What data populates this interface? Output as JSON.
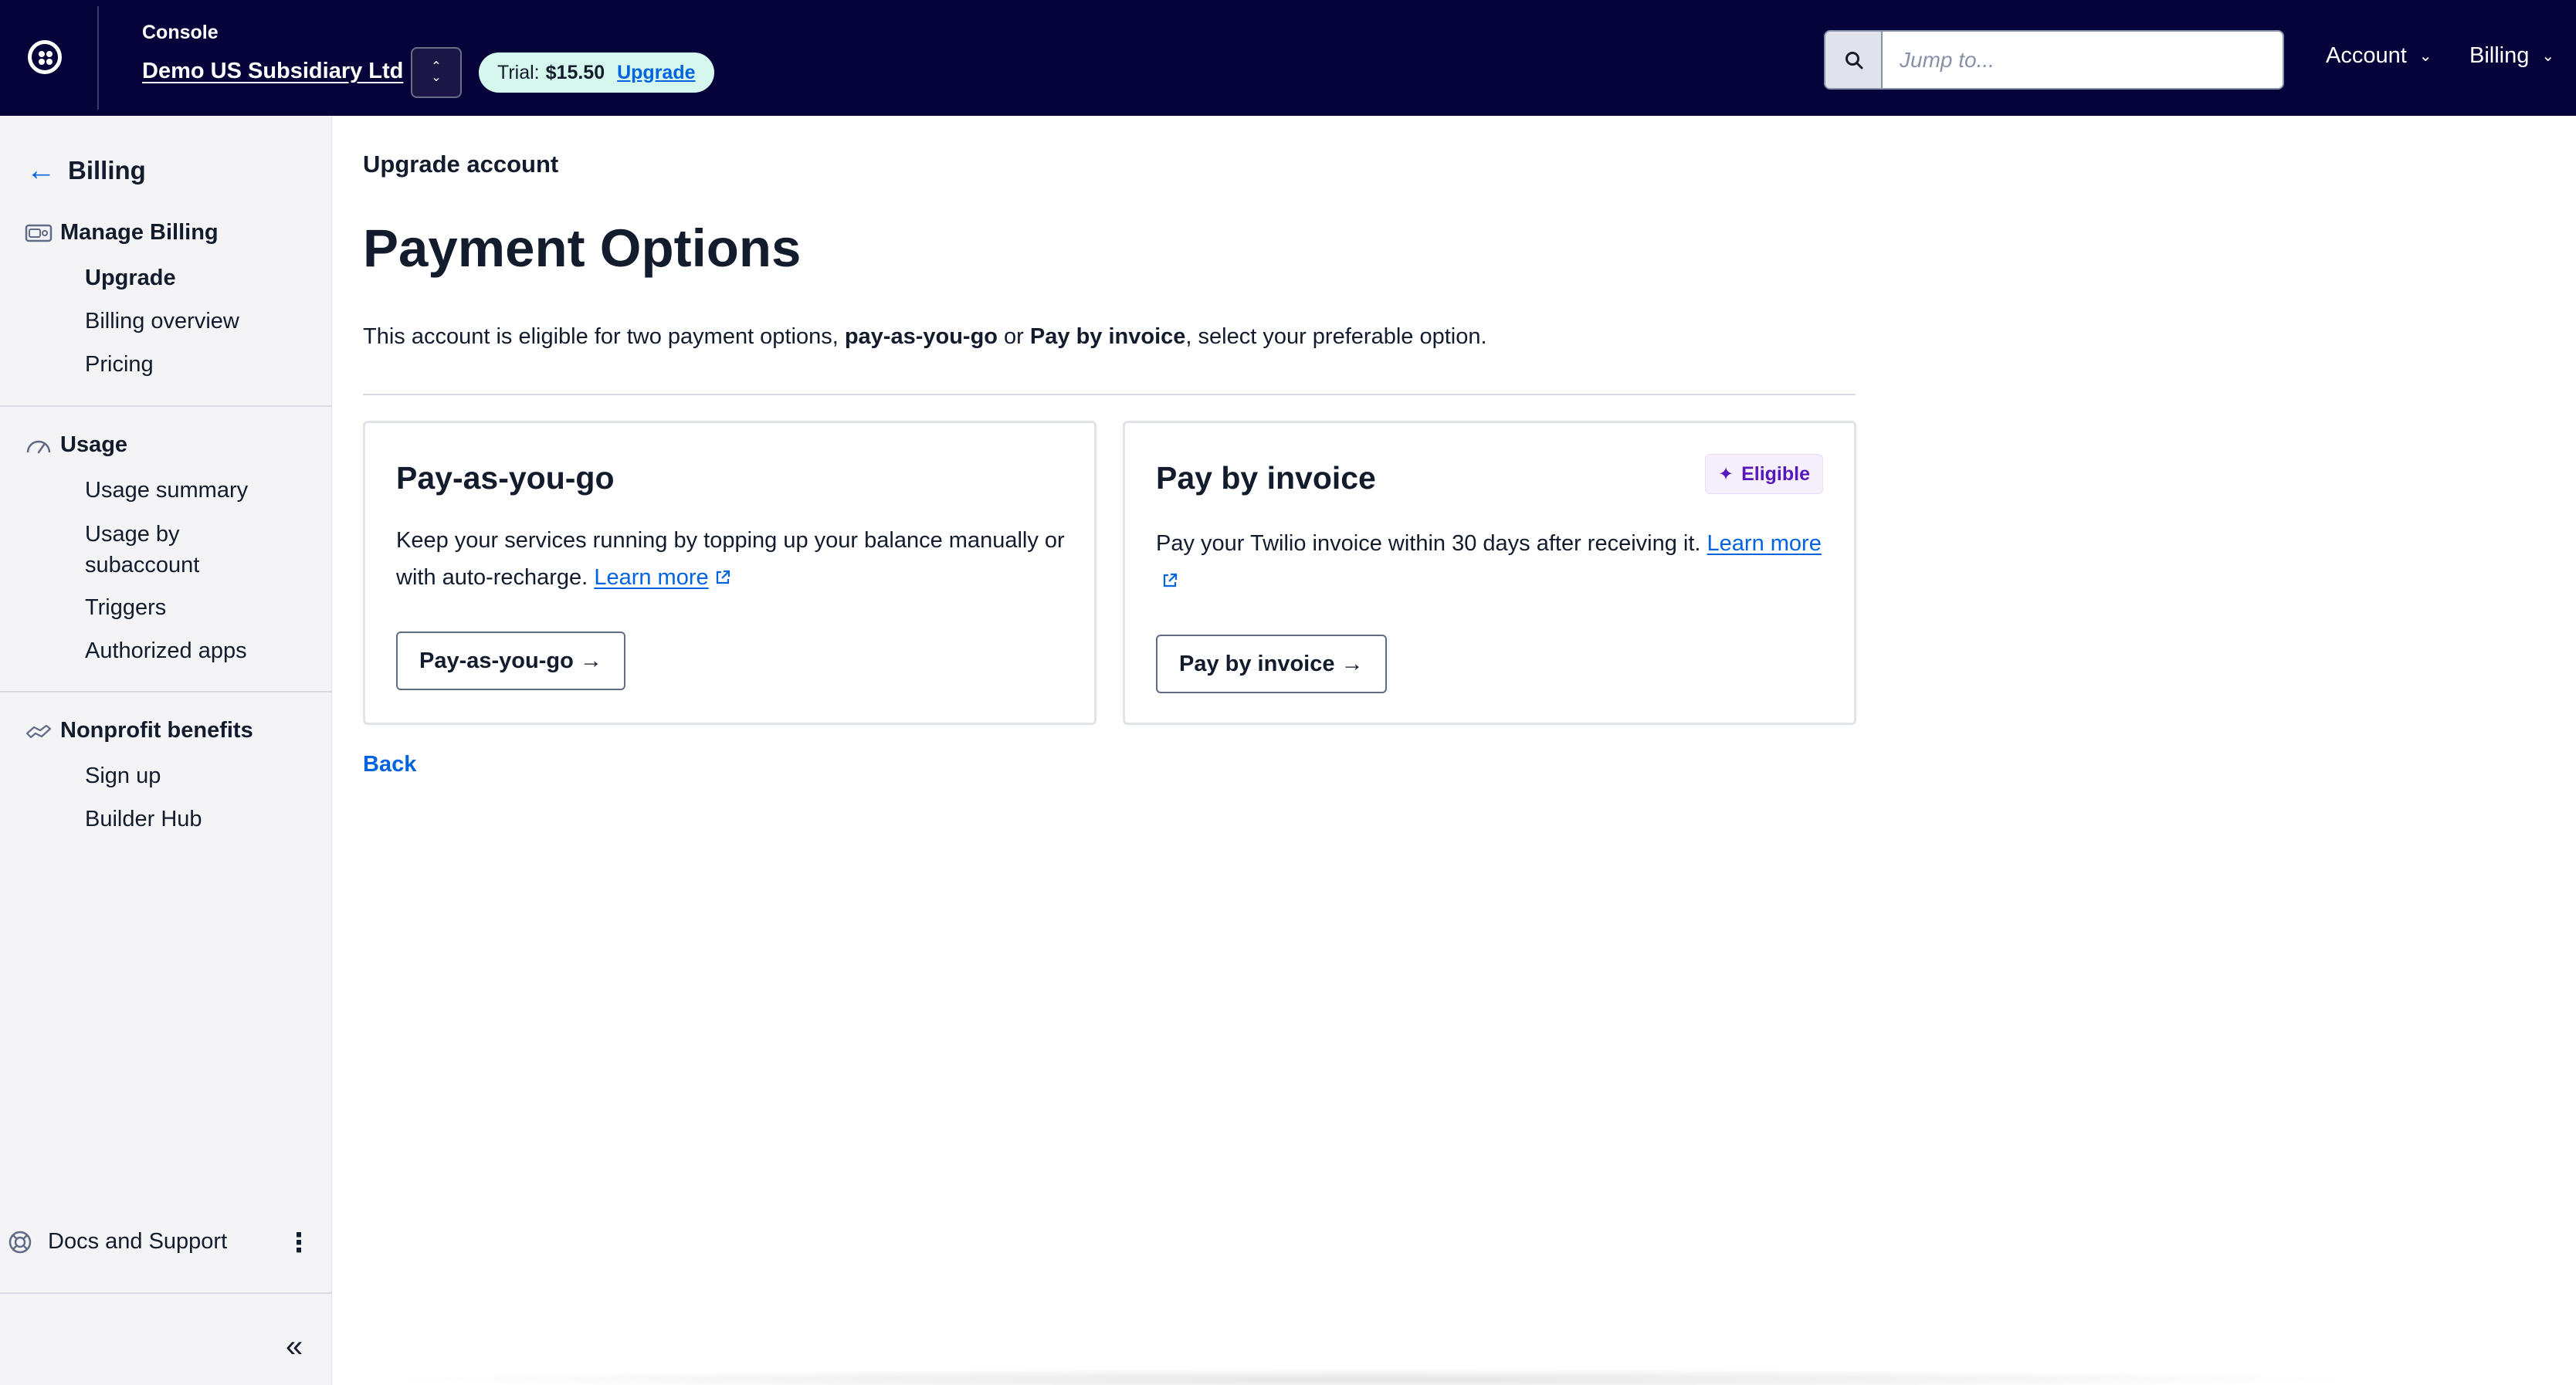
{
  "topbar": {
    "console_label": "Console",
    "account_name": "Demo US Subsidiary Ltd",
    "trial_label": "Trial:",
    "trial_amount": "$15.50",
    "upgrade_link": "Upgrade",
    "search_placeholder": "Jump to...",
    "nav": {
      "account": "Account",
      "billing": "Billing"
    }
  },
  "sidebar": {
    "back_title": "Billing",
    "groups": [
      {
        "title": "Manage Billing",
        "icon": "billing-card-icon",
        "items": [
          "Upgrade",
          "Billing overview",
          "Pricing"
        ]
      },
      {
        "title": "Usage",
        "icon": "gauge-icon",
        "items": [
          "Usage summary",
          "Usage by",
          "subaccount",
          "Triggers",
          "Authorized apps"
        ]
      },
      {
        "title": "Nonprofit benefits",
        "icon": "handshake-icon",
        "items": [
          "Sign up",
          "Builder Hub"
        ]
      }
    ],
    "active_item": "Upgrade",
    "docs_label": "Docs and Support"
  },
  "main": {
    "breadcrumb": "Upgrade account",
    "title": "Payment Options",
    "intro": {
      "part1": "This account is eligible for two payment options, ",
      "bold1": "pay-as-you-go",
      "part2": " or ",
      "bold2": "Pay by invoice",
      "part3": ", select your preferable option."
    },
    "cards": [
      {
        "title": "Pay-as-you-go",
        "desc": "Keep your services running by topping up your balance manually or with auto-recharge.",
        "link": "Learn more",
        "button": "Pay-as-you-go →"
      },
      {
        "title": "Pay by invoice",
        "badge": "Eligible",
        "desc": "Pay your Twilio invoice within 30 days after receiving it.",
        "link": "Learn more",
        "button": "Pay by invoice →"
      }
    ],
    "back_link": "Back"
  },
  "colors": {
    "topbar_bg": "#06033a",
    "link_blue": "#0263e0",
    "trial_pill_bg": "#d6f7ee",
    "badge_purple": "#5817bd",
    "sidebar_bg": "#f4f4f6"
  }
}
